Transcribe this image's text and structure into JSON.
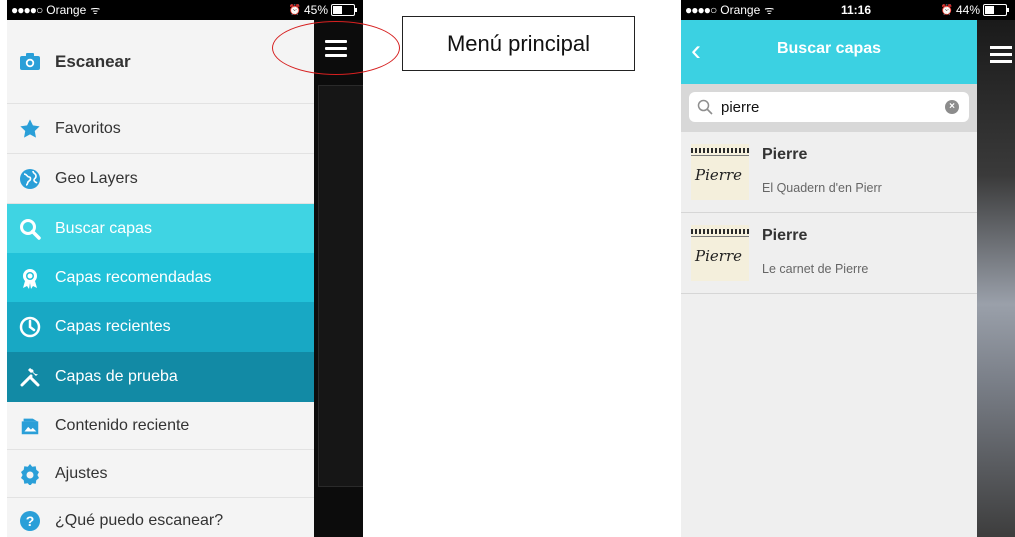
{
  "left_phone": {
    "status": {
      "signal": "●●●●○",
      "carrier": "Orange",
      "wifi": "ᯤ",
      "alarm": "⏰",
      "battery": "45%",
      "battery_level": 0.45
    },
    "menu": [
      {
        "label": "Escanear",
        "icon": "camera-icon",
        "bold": true
      },
      {
        "label": "Favoritos",
        "icon": "star-icon"
      },
      {
        "label": "Geo Layers",
        "icon": "globe-icon"
      },
      {
        "label": "Buscar capas",
        "icon": "search-icon"
      },
      {
        "label": "Capas recomendadas",
        "icon": "award-icon"
      },
      {
        "label": "Capas recientes",
        "icon": "clock-icon"
      },
      {
        "label": "Capas de prueba",
        "icon": "tools-icon"
      },
      {
        "label": "Contenido reciente",
        "icon": "folder-icon"
      },
      {
        "label": "Ajustes",
        "icon": "gear-icon"
      },
      {
        "label": "¿Qué puedo escanear?",
        "icon": "help-icon"
      }
    ],
    "colors": {
      "buscar": "#3fd4e3",
      "recomendadas": "#22c2d9",
      "recientes": "#18a8c4",
      "prueba": "#128aa5",
      "icon_blue": "#2a9fd8"
    }
  },
  "annotation": {
    "label": "Menú principal"
  },
  "right_phone": {
    "status": {
      "signal": "●●●●○",
      "carrier": "Orange",
      "wifi": "ᯤ",
      "time": "11:16",
      "alarm": "⏰",
      "battery": "44%",
      "battery_level": 0.44
    },
    "header": {
      "title": "Buscar capas",
      "back": "‹"
    },
    "search": {
      "value": "pierre",
      "placeholder": ""
    },
    "results": [
      {
        "title": "Pierre",
        "subtitle": "El Quadern d'en Pierr",
        "thumb_text": "Pierre"
      },
      {
        "title": "Pierre",
        "subtitle": "Le carnet de Pierre",
        "thumb_text": "Pierre"
      }
    ]
  }
}
